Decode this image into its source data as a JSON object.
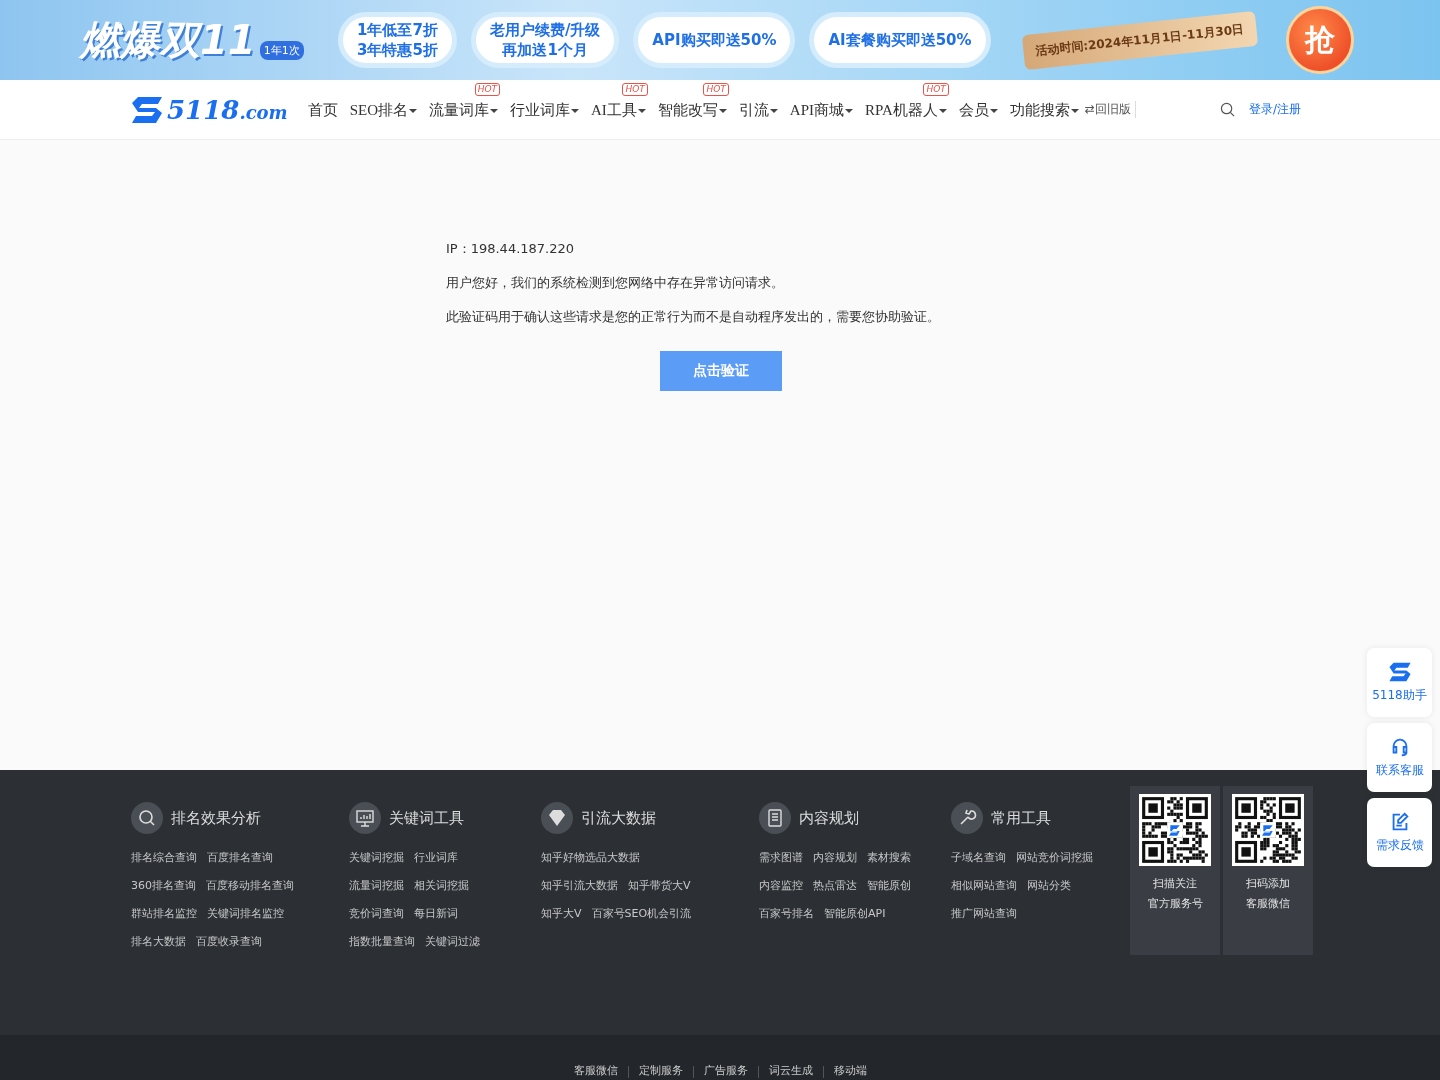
{
  "banner": {
    "title": "燃爆双11",
    "badge": "1年1次",
    "pills": [
      [
        "1年低至7折",
        "3年特惠5折"
      ],
      [
        "老用户续费/升级",
        "再加送1个月"
      ],
      [
        "API购买即送50%"
      ],
      [
        "AI套餐购买即送50%"
      ]
    ],
    "ribbon": "活动时间:2024年11月1日-11月30日",
    "grab": "抢"
  },
  "nav": {
    "logo": "5118",
    "logo_suffix": ".com",
    "items": [
      {
        "label": "首页",
        "dropdown": false
      },
      {
        "label": "SEO排名",
        "dropdown": true
      },
      {
        "label": "流量词库",
        "dropdown": true,
        "badge": "HOT"
      },
      {
        "label": "行业词库",
        "dropdown": true
      },
      {
        "label": "AI工具",
        "dropdown": true,
        "badge": "HOT"
      },
      {
        "label": "智能改写",
        "dropdown": true,
        "badge": "HOT"
      },
      {
        "label": "引流",
        "dropdown": true
      },
      {
        "label": "API商城",
        "dropdown": true
      },
      {
        "label": "RPA机器人",
        "dropdown": true,
        "badge": "HOT"
      },
      {
        "label": "会员",
        "dropdown": true
      },
      {
        "label": "功能搜索",
        "dropdown": true
      }
    ],
    "old_version": "⇄回旧版",
    "login": "登录/注册"
  },
  "notice": {
    "ip": "IP：198.44.187.220",
    "lines": [
      "用户您好，我们的系统检测到您网络中存在异常访问请求。",
      "此验证码用于确认这些请求是您的正常行为而不是自动程序发出的，需要您协助验证。"
    ],
    "button": "点击验证"
  },
  "footer": {
    "groups": [
      {
        "kind": "rank",
        "title": "排名效果分析",
        "rows": [
          [
            "排名综合查询",
            "百度排名查询"
          ],
          [
            "360排名查询",
            "百度移动排名查询"
          ],
          [
            "群站排名监控",
            "关键词排名监控"
          ],
          [
            "排名大数据",
            "百度收录查询"
          ]
        ]
      },
      {
        "kind": "monitor",
        "title": "关键词工具",
        "rows": [
          [
            "关键词挖掘",
            "行业词库"
          ],
          [
            "流量词挖掘",
            "相关词挖掘"
          ],
          [
            "竞价词查询",
            "每日新词"
          ],
          [
            "指数批量查询",
            "关键词过滤"
          ]
        ]
      },
      {
        "kind": "diamond",
        "title": "引流大数据",
        "rows": [
          [
            "知乎好物选品大数据"
          ],
          [
            "知乎引流大数据",
            "知乎带货大V"
          ],
          [
            "知乎大V",
            "百家号SEO机会引流"
          ]
        ]
      },
      {
        "kind": "document",
        "title": "内容规划",
        "rows": [
          [
            "需求图谱",
            "内容规划",
            "素材搜索"
          ],
          [
            "内容监控",
            "热点雷达",
            "智能原创"
          ],
          [
            "百家号排名",
            "智能原创API"
          ]
        ]
      },
      {
        "kind": "wrench",
        "title": "常用工具",
        "rows": [
          [
            "子域名查询",
            "网站竞价词挖掘"
          ],
          [
            "相似网站查询",
            "网站分类"
          ],
          [
            "推广网站查询"
          ]
        ]
      }
    ],
    "qrcodes": [
      {
        "lines": [
          "扫描关注",
          "官方服务号"
        ]
      },
      {
        "lines": [
          "扫码添加",
          "客服微信"
        ]
      }
    ],
    "bottom_links": [
      "客服微信",
      "定制服务",
      "广告服务",
      "词云生成",
      "移动端"
    ]
  },
  "side": [
    {
      "kind": "logo",
      "label": "5118助手"
    },
    {
      "kind": "headset",
      "label": "联系客服"
    },
    {
      "kind": "edit",
      "label": "需求反馈"
    }
  ]
}
